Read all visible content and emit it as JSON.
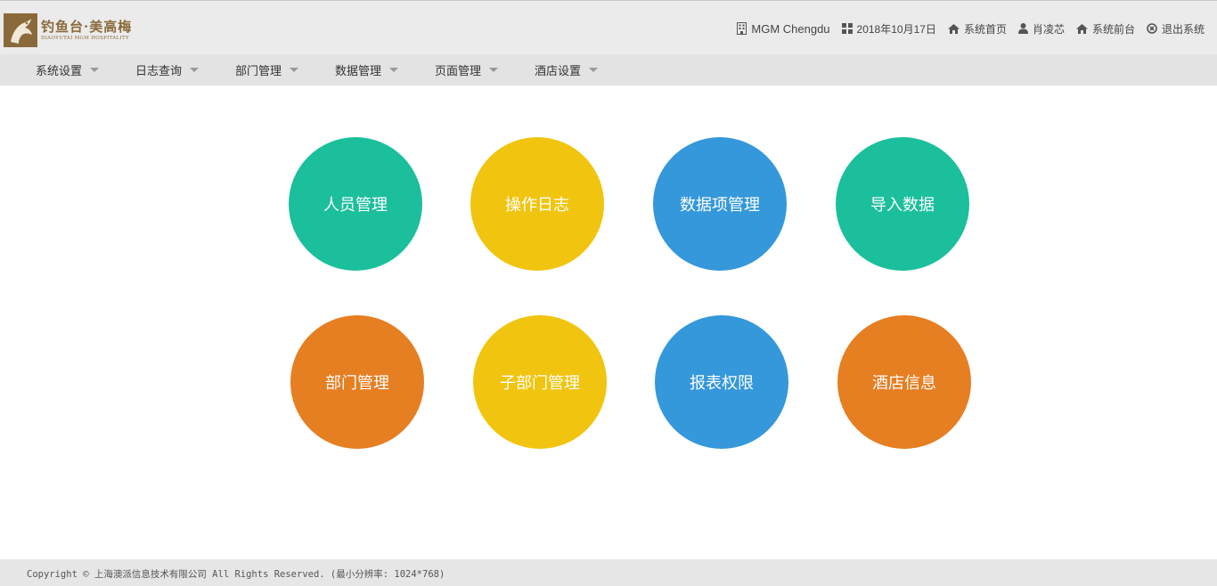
{
  "brand": {
    "logo_cn": "钓鱼台·美高梅",
    "logo_en": "DIAOYUTAI MGM HOSPITALITY",
    "color": "#8a6a3a"
  },
  "header": {
    "links": [
      {
        "label": "MGM Chengdu",
        "icon": "building-icon"
      },
      {
        "label": "2018年10月17日",
        "icon": "grid-icon"
      },
      {
        "label": "系统首页",
        "icon": "home-icon"
      },
      {
        "label": "肖凌芯",
        "icon": "user-icon"
      },
      {
        "label": "系统前台",
        "icon": "home-icon"
      },
      {
        "label": "退出系统",
        "icon": "close-circle-icon"
      }
    ]
  },
  "nav": {
    "items": [
      {
        "label": "系统设置"
      },
      {
        "label": "日志查询"
      },
      {
        "label": "部门管理"
      },
      {
        "label": "数据管理"
      },
      {
        "label": "页面管理"
      },
      {
        "label": "酒店设置"
      }
    ]
  },
  "tiles": [
    {
      "label": "人员管理",
      "color": "#1bbf9c"
    },
    {
      "label": "操作日志",
      "color": "#f1c40f"
    },
    {
      "label": "数据项管理",
      "color": "#3498db"
    },
    {
      "label": "导入数据",
      "color": "#1bbf9c"
    },
    {
      "label": "部门管理",
      "color": "#e67e22"
    },
    {
      "label": "子部门管理",
      "color": "#f1c40f"
    },
    {
      "label": "报表权限",
      "color": "#3498db"
    },
    {
      "label": "酒店信息",
      "color": "#e67e22"
    }
  ],
  "footer": {
    "text": "Copyright © 上海澳派信息技术有限公司 All Rights Reserved. (最小分辨率: 1024*768)"
  }
}
